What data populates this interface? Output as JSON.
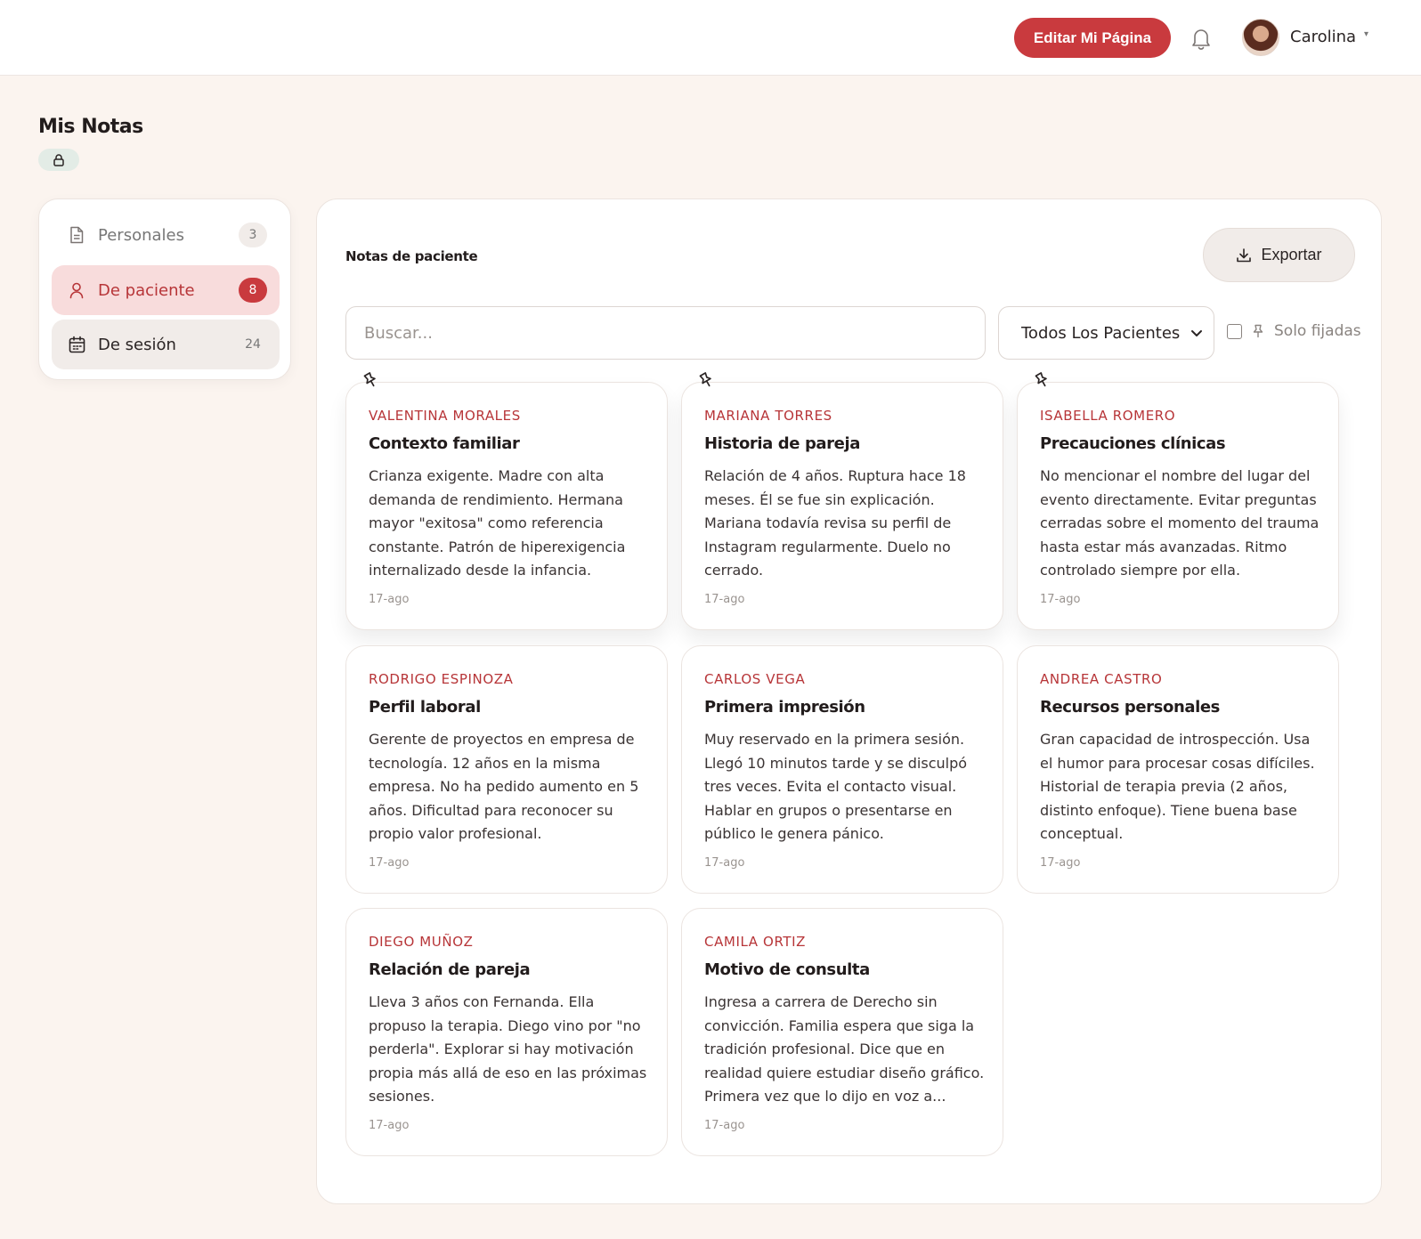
{
  "header": {
    "edit_page_label": "Editar Mi Página",
    "username": "Carolina",
    "caret": "▾"
  },
  "page": {
    "title": "Mis Notas"
  },
  "sidebar": {
    "items": [
      {
        "label": "Personales",
        "count": "3",
        "icon": "document-icon"
      },
      {
        "label": "De paciente",
        "count": "8",
        "icon": "user-icon"
      },
      {
        "label": "De sesión",
        "count": "24",
        "icon": "calendar-icon"
      }
    ]
  },
  "main": {
    "title": "Notas de paciente",
    "export_label": "Exportar",
    "search_placeholder": "Buscar...",
    "filter_selected": "Todos Los Pacientes",
    "pinned_only_label": "Solo fijadas"
  },
  "colors": {
    "accent": "#c93a3e",
    "background": "#fbf4ef",
    "patient_name": "#b73538"
  },
  "notes": [
    {
      "patient": "Valentina Morales",
      "title": "Contexto familiar",
      "body": "Crianza exigente. Madre con alta demanda de rendimiento. Hermana mayor \"exitosa\" como referencia constante. Patrón de hiperexigencia internalizado desde la infancia.",
      "date": "17-ago",
      "pinned": true
    },
    {
      "patient": "Mariana Torres",
      "title": "Historia de pareja",
      "body": "Relación de 4 años. Ruptura hace 18 meses. Él se fue sin explicación. Mariana todavía revisa su perfil de Instagram regularmente. Duelo no cerrado.",
      "date": "17-ago",
      "pinned": true
    },
    {
      "patient": "Isabella Romero",
      "title": "Precauciones clínicas",
      "body": "No mencionar el nombre del lugar del evento directamente. Evitar preguntas cerradas sobre el momento del trauma hasta estar más avanzadas. Ritmo controlado siempre por ella.",
      "date": "17-ago",
      "pinned": true
    },
    {
      "patient": "Rodrigo Espinoza",
      "title": "Perfil laboral",
      "body": "Gerente de proyectos en empresa de tecnología. 12 años en la misma empresa. No ha pedido aumento en 5 años. Dificultad para reconocer su propio valor profesional.",
      "date": "17-ago",
      "pinned": false
    },
    {
      "patient": "Carlos Vega",
      "title": "Primera impresión",
      "body": "Muy reservado en la primera sesión. Llegó 10 minutos tarde y se disculpó tres veces. Evita el contacto visual. Hablar en grupos o presentarse en público le genera pánico.",
      "date": "17-ago",
      "pinned": false
    },
    {
      "patient": "Andrea Castro",
      "title": "Recursos personales",
      "body": "Gran capacidad de introspección. Usa el humor para procesar cosas difíciles. Historial de terapia previa (2 años, distinto enfoque). Tiene buena base conceptual.",
      "date": "17-ago",
      "pinned": false
    },
    {
      "patient": "Diego Muñoz",
      "title": "Relación de pareja",
      "body": "Lleva 3 años con Fernanda. Ella propuso la terapia. Diego vino por \"no perderla\". Explorar si hay motivación propia más allá de eso en las próximas sesiones.",
      "date": "17-ago",
      "pinned": false
    },
    {
      "patient": "Camila Ortiz",
      "title": "Motivo de consulta",
      "body": "Ingresa a carrera de Derecho sin convicción. Familia espera que siga la tradición profesional. Dice que en realidad quiere estudiar diseño gráfico. Primera vez que lo dijo en voz a...",
      "date": "17-ago",
      "pinned": false
    }
  ]
}
